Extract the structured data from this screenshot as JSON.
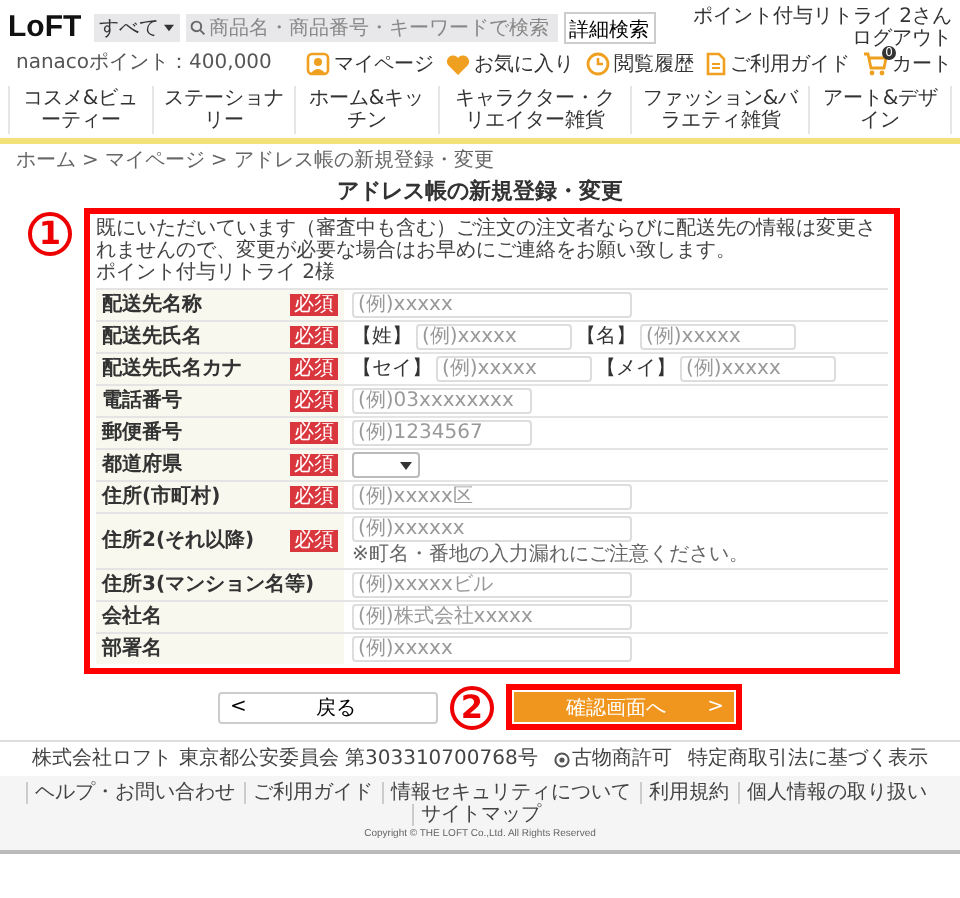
{
  "header": {
    "logo": "LoFT",
    "search": {
      "category": "すべて",
      "placeholder": "商品名・商品番号・キーワードで検索",
      "button": "詳細検索"
    },
    "user": {
      "greeting": "ポイント付与リトライ 2さん",
      "logout": "ログアウト",
      "points": "nanacoポイント：400,000"
    },
    "icons": [
      {
        "label": "マイページ",
        "kind": "person"
      },
      {
        "label": "お気に入り",
        "kind": "heart"
      },
      {
        "label": "閲覧履歴",
        "kind": "clock"
      },
      {
        "label": "ご利用ガイド",
        "kind": "doc"
      },
      {
        "label": "カート",
        "kind": "cart",
        "badge": "0"
      }
    ]
  },
  "nav": [
    "コスメ&ビューティー",
    "ステーショナリー",
    "ホーム&キッチン",
    "キャラクター・クリエイター雑貨",
    "ファッション&バラエティ雑貨",
    "アート&デザイン"
  ],
  "breadcrumb": {
    "separator": ">",
    "items": [
      "ホーム",
      "マイページ",
      "アドレス帳の新規登録・変更"
    ]
  },
  "title": "アドレス帳の新規登録・変更",
  "form": {
    "intro": "既にいただいています（審査中も含む）ご注文の注文者ならびに配送先の情報は変更されませんので、変更が必要な場合はお早めにご連絡をお願い致します。",
    "customer": "ポイント付与リトライ 2様",
    "rows": [
      {
        "label": "配送先名称",
        "badge": "必須",
        "kind": "text",
        "fields": [
          {
            "placeholder": "(例)xxxxx"
          }
        ]
      },
      {
        "label": "配送先氏名",
        "badge": "必須",
        "kind": "pair",
        "fields": [
          {
            "prefix": "【姓】",
            "placeholder": "(例)xxxxx"
          },
          {
            "prefix": "【名】",
            "placeholder": "(例)xxxxx"
          }
        ]
      },
      {
        "label": "配送先氏名カナ",
        "badge": "必須",
        "kind": "pair",
        "fields": [
          {
            "prefix": "【セイ】",
            "placeholder": "(例)xxxxx"
          },
          {
            "prefix": "【メイ】",
            "placeholder": "(例)xxxxx"
          }
        ]
      },
      {
        "label": "電話番号",
        "badge": "必須",
        "kind": "text",
        "fields": [
          {
            "placeholder": "(例)03xxxxxxxx"
          }
        ]
      },
      {
        "label": "郵便番号",
        "badge": "必須",
        "kind": "text",
        "fields": [
          {
            "placeholder": "(例)1234567"
          }
        ]
      },
      {
        "label": "都道府県",
        "badge": "必須",
        "kind": "select"
      },
      {
        "label": "住所(市町村)",
        "badge": "必須",
        "kind": "text",
        "fields": [
          {
            "placeholder": "(例)xxxxx区"
          }
        ]
      },
      {
        "label": "住所2(それ以降)",
        "badge": "必須",
        "kind": "text",
        "fields": [
          {
            "placeholder": "(例)xxxxxx"
          }
        ],
        "note": "※町名・番地の入力漏れにご注意ください。"
      },
      {
        "label": "住所3(マンション名等)",
        "kind": "text",
        "fields": [
          {
            "placeholder": "(例)xxxxxビル"
          }
        ]
      },
      {
        "label": "会社名",
        "kind": "text",
        "fields": [
          {
            "placeholder": "(例)株式会社xxxxx"
          }
        ]
      },
      {
        "label": "部署名",
        "kind": "text",
        "fields": [
          {
            "placeholder": "(例)xxxxx"
          }
        ]
      }
    ]
  },
  "buttons": {
    "back": {
      "arrow": "<",
      "label": "戻る"
    },
    "next": {
      "label": "確認画面へ",
      "arrow": ">"
    }
  },
  "annotations": [
    "1",
    "2"
  ],
  "footer": {
    "company": "株式会社ロフト 東京都公安委員会 第303310700768号",
    "license": "古物商許可",
    "legal": "特定商取引法に基づく表示",
    "links": [
      "ヘルプ・お問い合わせ",
      "ご利用ガイド",
      "情報セキュリティについて",
      "利用規約",
      "個人情報の取り扱い",
      "サイトマップ"
    ],
    "copyright": "Copyright © THE LOFT Co.,Ltd. All Rights Reserved"
  }
}
